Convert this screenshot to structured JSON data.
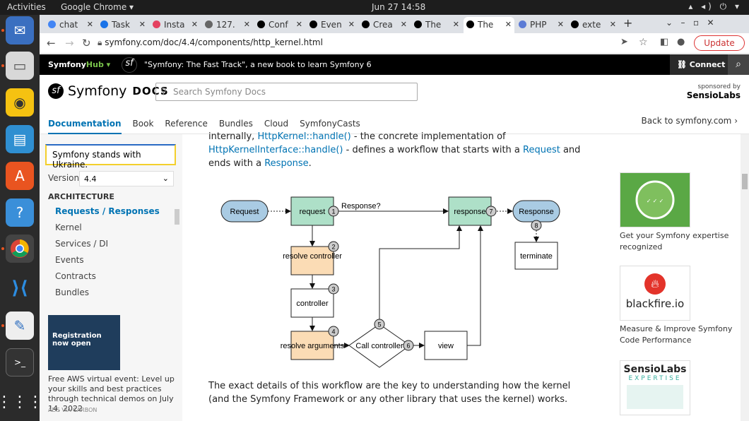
{
  "os": {
    "activities": "Activities",
    "app": "Google Chrome ▾",
    "clock": "Jun 27  14:58"
  },
  "dock": [
    "mail",
    "files",
    "rhythmbox",
    "writer",
    "software",
    "help",
    "chrome",
    "vscode",
    "text-editor",
    "terminal",
    "apps"
  ],
  "tabs": [
    "chat",
    "Task",
    "Insta",
    "127.",
    "Conf",
    "Even",
    "Crea",
    "The",
    "The",
    "PHP",
    "exte"
  ],
  "url": "symfony.com/doc/4.4/components/http_kernel.html",
  "update": "Update",
  "sfbar": {
    "hub_a": "Symfony",
    "hub_b": "Hub ▾",
    "promo": "\"Symfony: The Fast Track\", a new book to learn Symfony 6",
    "connect": "Connect"
  },
  "header": {
    "brand": "Symfony",
    "docs": "DOCS",
    "search_placeholder": "Search Symfony Docs",
    "sponsor_pre": "sponsored by",
    "sponsor": "SensioLabs",
    "back": "Back to symfony.com ›"
  },
  "menu": [
    "Documentation",
    "Book",
    "Reference",
    "Bundles",
    "Cloud",
    "SymfonyCasts"
  ],
  "sidebar": {
    "ukraine": "Symfony stands with Ukraine.",
    "version_label": "Version:",
    "version": "4.4",
    "section": "ARCHITECTURE",
    "items": [
      "Requests / Responses",
      "Kernel",
      "Services / DI",
      "Events",
      "Contracts",
      "Bundles"
    ],
    "ad_title": "Registration now open",
    "ad_text": "Free AWS virtual event: Level up your skills and best practices through technical demos on July 14, 2022",
    "ad_src": "ADS VIA CARBON"
  },
  "content": {
    "p1a": "internally, ",
    "l1": "HttpKernel::handle()",
    "p1b": " - the concrete implementation of ",
    "l2": "HttpKernelInterface::handle()",
    "p1c": " - defines a workflow that starts with a ",
    "l3": "Request",
    "p1d": " and ends with a ",
    "l4": "Response",
    "p1e": ".",
    "p2": "The exact details of this workflow are the key to understanding how the kernel (and the Symfony Framework or any other library that uses the kernel) works."
  },
  "diagram": {
    "request_in": "Request",
    "request": "request",
    "response_q": "Response?",
    "response": "response",
    "response_out": "Response",
    "terminate": "terminate",
    "resolve_controller": "resolve controller",
    "controller": "controller",
    "resolve_arguments": "resolve arguments",
    "call_controller": "Call controller",
    "view": "view",
    "steps": [
      "1",
      "2",
      "3",
      "4",
      "5",
      "6",
      "7",
      "8"
    ]
  },
  "right": {
    "cert_text": "Get your Symfony expertise recognized",
    "bf_logo": "blackfire.io",
    "bf_text": "Measure & Improve Symfony Code Performance",
    "sl_logo": "SensioLabs",
    "sl_sub": "EXPERTISE"
  }
}
